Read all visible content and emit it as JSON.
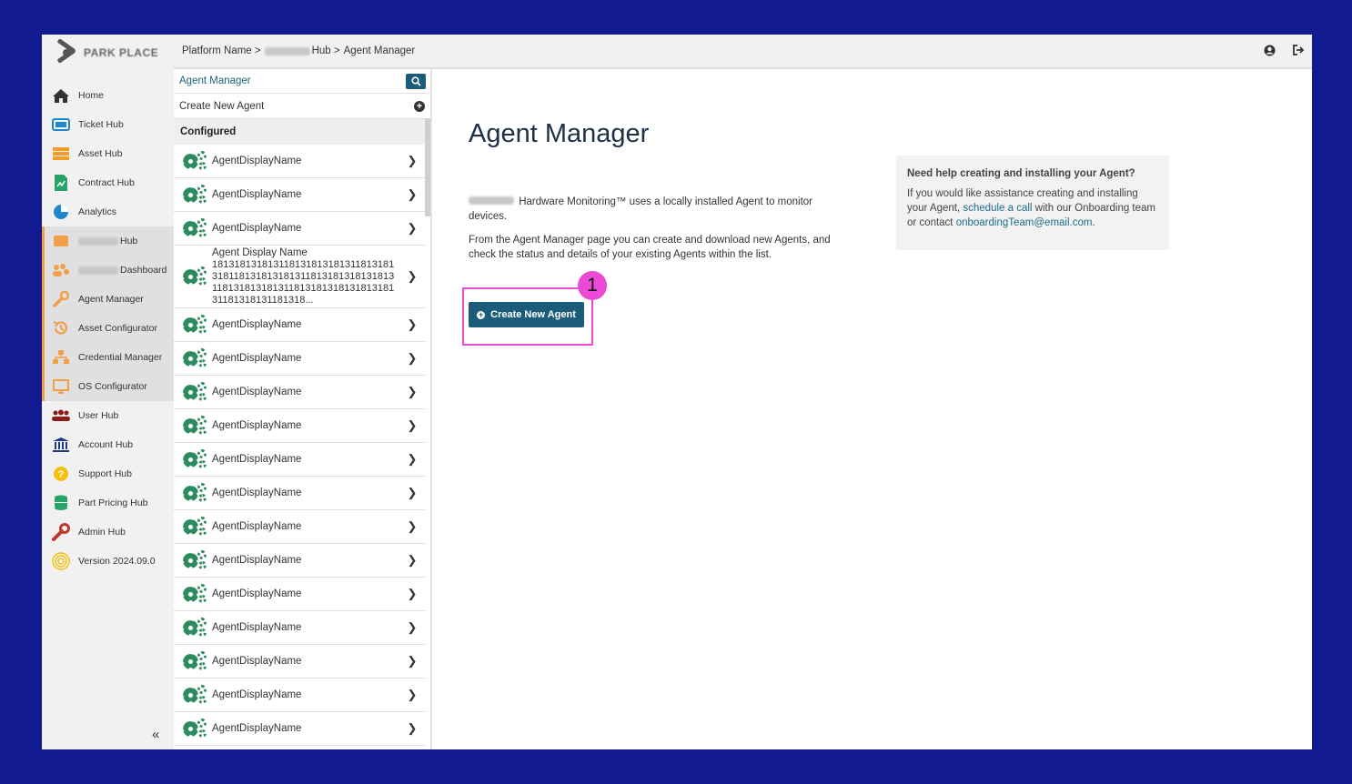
{
  "header": {
    "breadcrumb_root": "Platform Name >",
    "breadcrumb_hub": "Hub >",
    "breadcrumb_current": "Agent Manager"
  },
  "sidebar": {
    "logo_text": "PARK PLACE",
    "items": [
      {
        "label": "Home",
        "icon": "home-icon",
        "color": "#333333"
      },
      {
        "label": "Ticket Hub",
        "icon": "ticket-icon",
        "color": "#1e88c9"
      },
      {
        "label": "Asset Hub",
        "icon": "asset-icon",
        "color": "#f39c2b"
      },
      {
        "label": "Contract Hub",
        "icon": "contract-icon",
        "color": "#27a36a"
      },
      {
        "label": "Analytics",
        "icon": "analytics-icon",
        "color": "#1e88c9"
      },
      {
        "label": "Hub",
        "icon": "hub-icon",
        "color": "#f0a04b"
      },
      {
        "label": "Dashboard",
        "icon": "dashboard-icon",
        "color": "#f0a04b"
      },
      {
        "label": "Agent Manager",
        "icon": "wrench-icon",
        "color": "#f0a04b"
      },
      {
        "label": "Asset Configurator",
        "icon": "configurator-icon",
        "color": "#f0a04b"
      },
      {
        "label": "Credential Manager",
        "icon": "credential-icon",
        "color": "#f0a04b"
      },
      {
        "label": "OS Configurator",
        "icon": "monitor-icon",
        "color": "#f0a04b"
      },
      {
        "label": "User Hub",
        "icon": "users-icon",
        "color": "#8b1a1a"
      },
      {
        "label": "Account Hub",
        "icon": "bank-icon",
        "color": "#1f3a8a"
      },
      {
        "label": "Support Hub",
        "icon": "support-icon",
        "color": "#f4c20d"
      },
      {
        "label": "Part Pricing Hub",
        "icon": "database-icon",
        "color": "#27a36a"
      },
      {
        "label": "Admin Hub",
        "icon": "admin-wrench-icon",
        "color": "#c0392b"
      },
      {
        "label": "Version 2024.09.0",
        "icon": "fingerprint-icon",
        "color": "#f4c20d"
      }
    ]
  },
  "list": {
    "search_value": "Agent Manager",
    "create_label": "Create New Agent",
    "section_label": "Configured",
    "agents": [
      {
        "name": "AgentDisplayName"
      },
      {
        "name": "AgentDisplayName"
      },
      {
        "name": "AgentDisplayName"
      },
      {
        "name": "Agent Display Name",
        "id": "18131813181311813181318131181318131811813181318131181318131813181311813181318131181318131813181318131181318131181318..."
      },
      {
        "name": "AgentDisplayName"
      },
      {
        "name": "AgentDisplayName"
      },
      {
        "name": "AgentDisplayName"
      },
      {
        "name": "AgentDisplayName"
      },
      {
        "name": "AgentDisplayName"
      },
      {
        "name": "AgentDisplayName"
      },
      {
        "name": "AgentDisplayName"
      },
      {
        "name": "AgentDisplayName"
      },
      {
        "name": "AgentDisplayName"
      },
      {
        "name": "AgentDisplayName"
      },
      {
        "name": "AgentDisplayName"
      },
      {
        "name": "AgentDisplayName"
      },
      {
        "name": "AgentDisplayName"
      }
    ]
  },
  "main": {
    "title": "Agent Manager",
    "desc1": "Hardware Monitoring™ uses a locally installed Agent to monitor devices.",
    "desc2": "From the Agent Manager page you can create and download new Agents, and check the status and details of your existing Agents within the list.",
    "cta_label": "Create New Agent",
    "badge": "1",
    "accent_color": "#1b5c7a",
    "highlight_color": "#e94ad3"
  },
  "help": {
    "title": "Need help creating and installing your Agent?",
    "text_before": "If you would like assistance creating and installing your Agent,",
    "link_schedule": "schedule a call",
    "text_middle": "with our Onboarding team or contact",
    "link_email": "onboardingTeam@email.com",
    "text_after": "."
  }
}
